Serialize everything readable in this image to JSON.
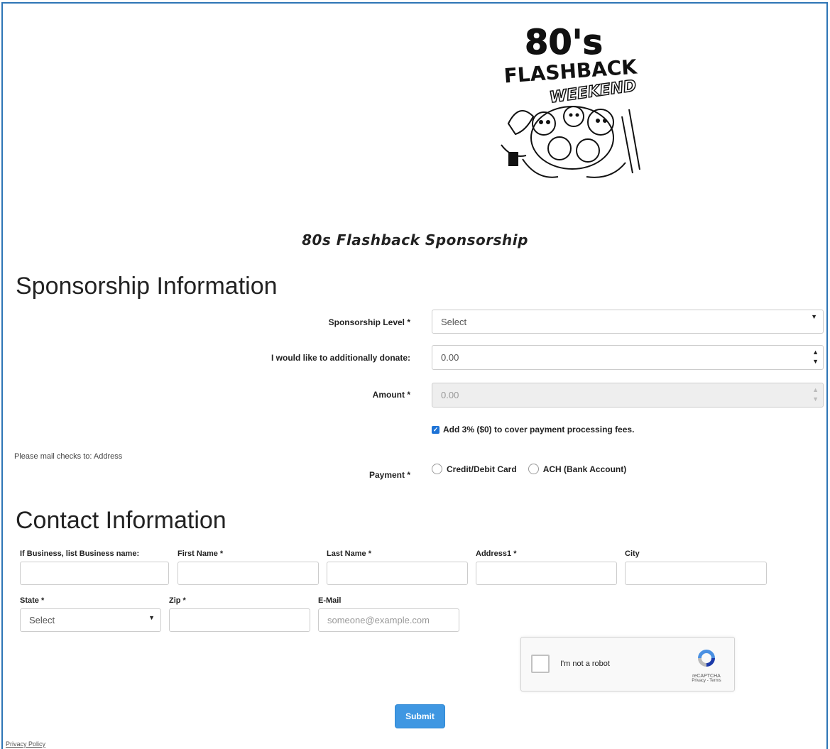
{
  "form": {
    "title": "80s Flashback Sponsorship",
    "logo_text_top": "80's",
    "logo_text_mid": "FLASHBACK",
    "logo_text_bottom": "WEEKEND"
  },
  "sponsorship": {
    "heading": "Sponsorship Information",
    "level_label": "Sponsorship Level *",
    "level_value": "Select",
    "donate_label": "I would like to additionally donate:",
    "donate_value": "0.00",
    "amount_label": "Amount *",
    "amount_value": "0.00",
    "fee_checkbox_label": "Add 3% ($0) to cover payment processing fees.",
    "fee_checked": true,
    "mail_note": "Please mail checks to: Address",
    "payment_label": "Payment *",
    "payment_options": [
      "Credit/Debit Card",
      "ACH (Bank Account)"
    ]
  },
  "contact": {
    "heading": "Contact Information",
    "business_label": "If Business, list Business name:",
    "first_name_label": "First Name *",
    "last_name_label": "Last Name *",
    "address1_label": "Address1 *",
    "city_label": "City",
    "state_label": "State *",
    "state_value": "Select",
    "zip_label": "Zip *",
    "email_label": "E-Mail",
    "email_placeholder": "someone@example.com"
  },
  "captcha": {
    "label": "I'm not a robot",
    "brand": "reCAPTCHA",
    "terms": "Privacy - Terms"
  },
  "actions": {
    "submit_label": "Submit",
    "privacy_link": "Privacy Policy"
  },
  "colors": {
    "frame_border": "#2e75b6",
    "submit_bg": "#3f97e2",
    "checkbox_on": "#1e73d6"
  }
}
